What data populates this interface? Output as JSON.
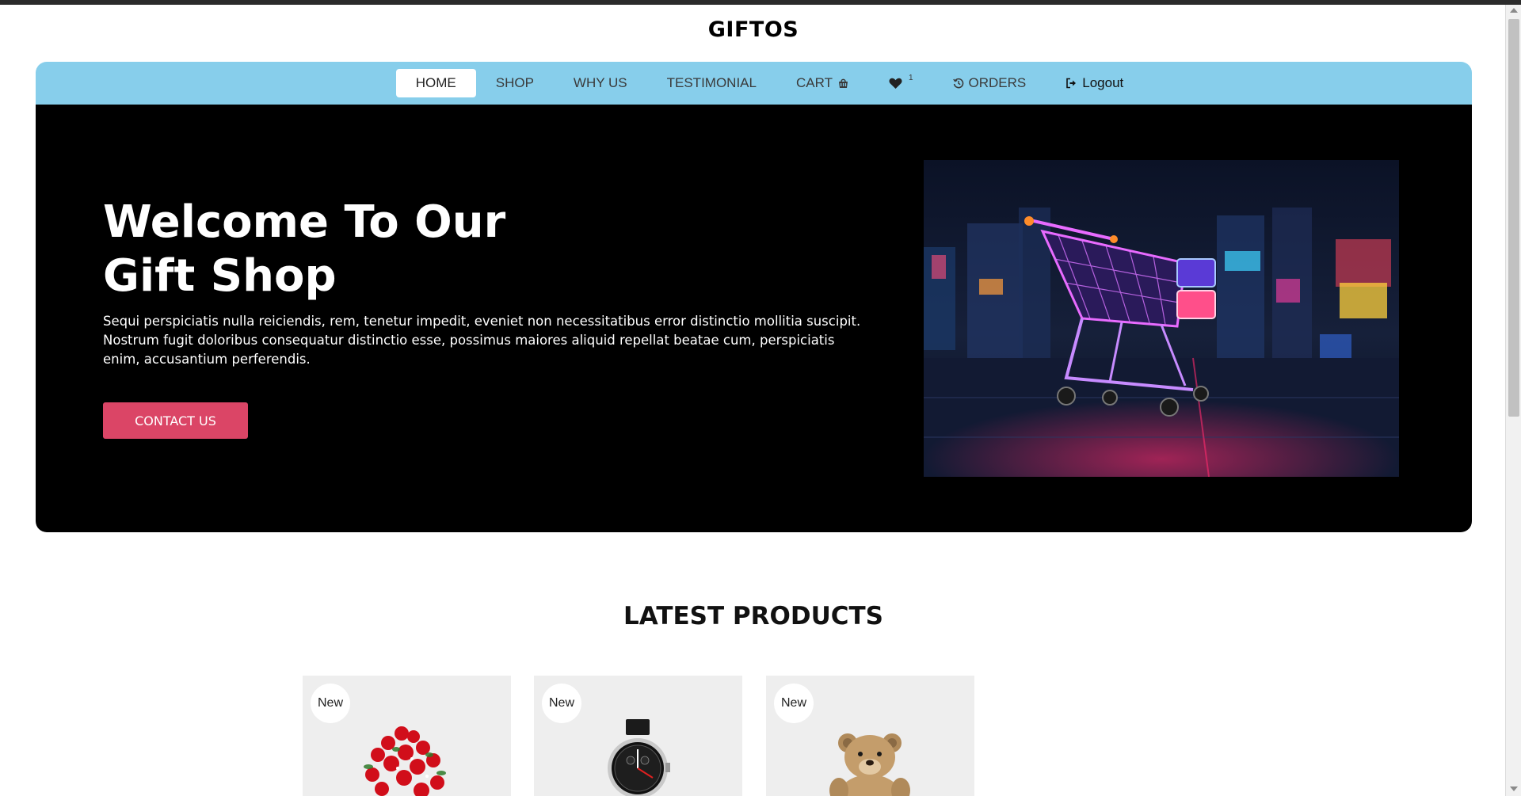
{
  "brand": {
    "name": "GIFTOS"
  },
  "nav": {
    "home": "HOME",
    "shop": "SHOP",
    "why_us": "WHY US",
    "testimonial": "TESTIMONIAL",
    "cart": "CART",
    "wishlist_count": "1",
    "orders": "ORDERS",
    "logout": "Logout"
  },
  "hero": {
    "title_line1": "Welcome To Our",
    "title_line2": "Gift Shop",
    "text": "Sequi perspiciatis nulla reiciendis, rem, tenetur impedit, eveniet non necessitatibus error distinctio mollitia suscipit. Nostrum fugit doloribus consequatur distinctio esse, possimus maiores aliquid repellat beatae cum, perspiciatis enim, accusantium perferendis.",
    "button": "CONTACT US"
  },
  "latest": {
    "title": "LATEST PRODUCTS",
    "products": [
      {
        "badge": "New"
      },
      {
        "badge": "New"
      },
      {
        "badge": "New"
      }
    ]
  },
  "colors": {
    "nav_bg": "#87ceeb",
    "hero_bg": "#000000",
    "button": "#db4566",
    "card_bg": "#eeeeee"
  }
}
